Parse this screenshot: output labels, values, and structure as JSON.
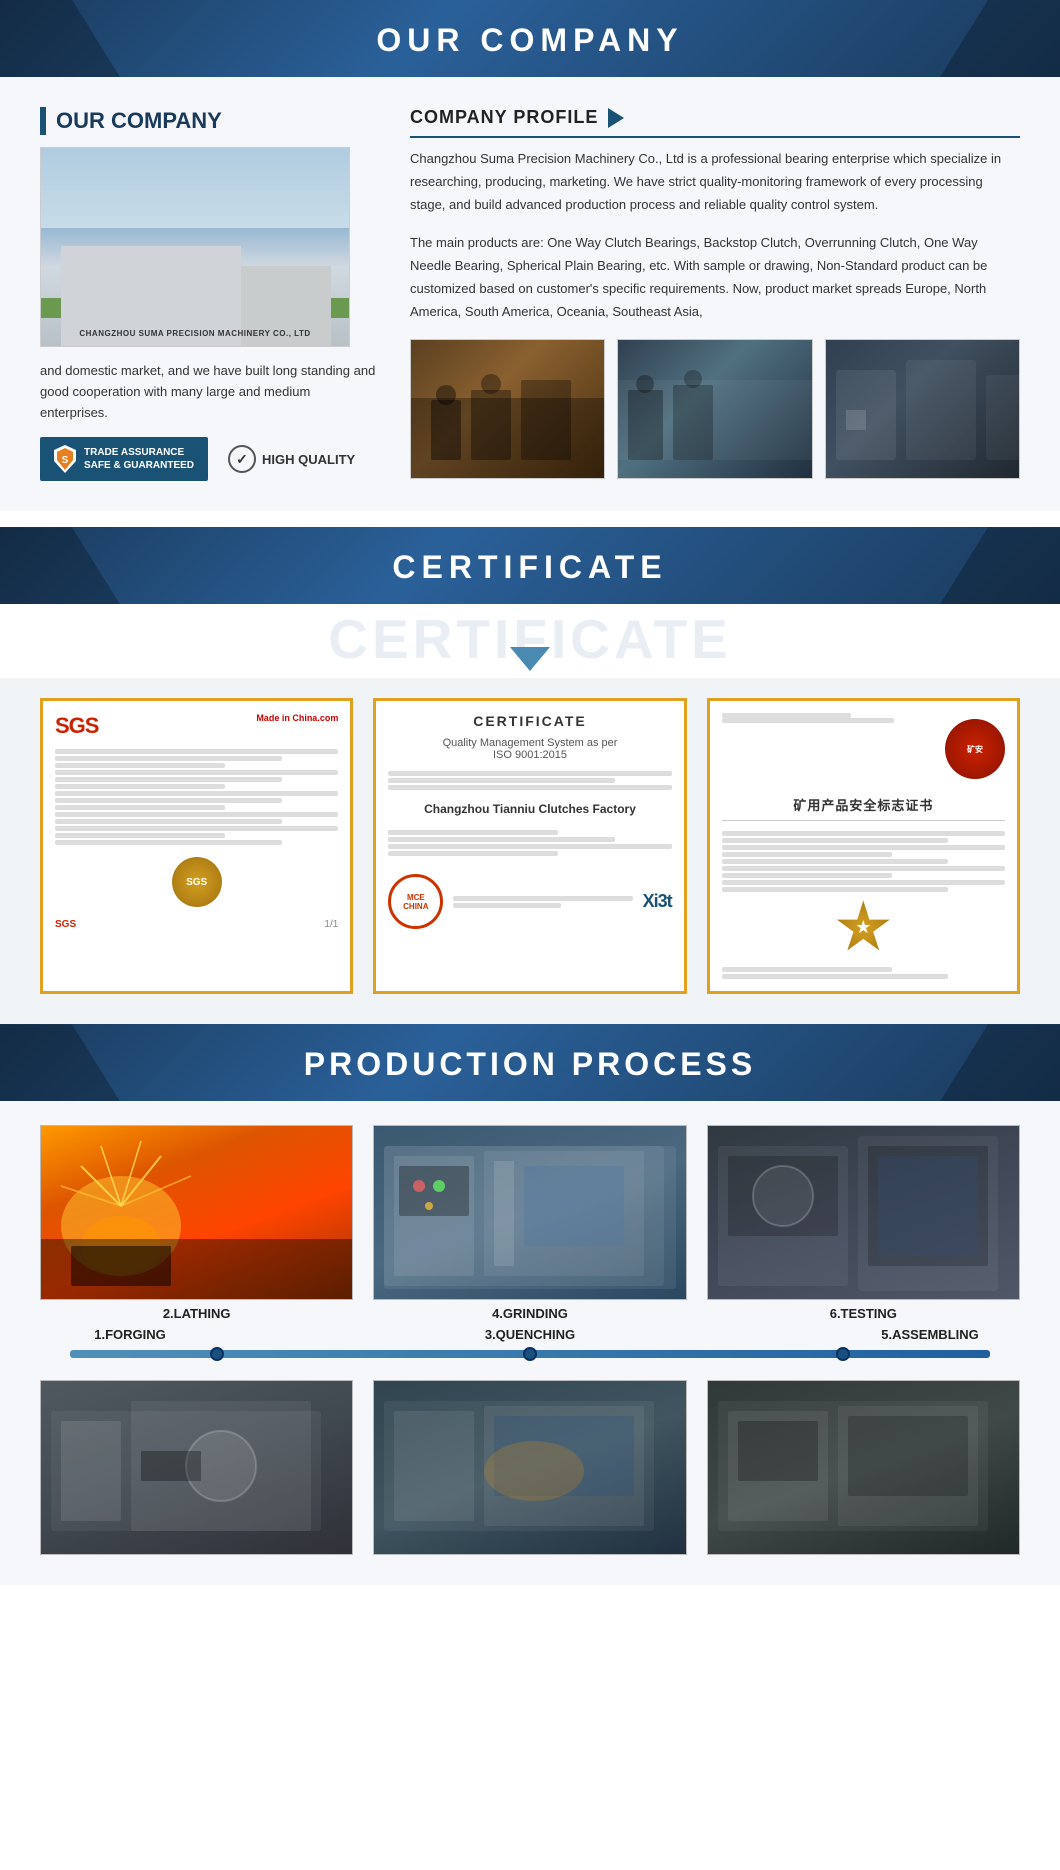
{
  "header": {
    "title": "OUR  COMPANY"
  },
  "company": {
    "section_title": "OUR COMPANY",
    "profile_title": "COMPANY PROFILE",
    "profile_text1": "Changzhou Suma Precision Machinery Co., Ltd is a professional bearing enterprise which specialize in researching, producing, marketing. We have strict quality-monitoring framework of every processing stage, and build advanced production process and reliable quality control system.",
    "profile_text2": "The main products are: One Way Clutch Bearings, Backstop Clutch, Overrunning Clutch, One Way Needle Bearing, Spherical Plain Bearing, etc. With sample or drawing, Non-Standard product can be customized based on customer's specific requirements. Now, product market spreads Europe, North America, South America, Oceania, Southeast Asia,",
    "text_below": "and domestic market, and we have built long standing and good cooperation with many large and medium enterprises.",
    "badge_trade": "TRADE ASSURANCE\nSAFE & GUARANTEED",
    "badge_quality": "HIGH QUALITY",
    "building_text": "CHANGZHOU SUMA PRECISION MACHINERY CO., LTD"
  },
  "certificate": {
    "title": "CERTIFICATE",
    "watermark": "CERTIFICATE",
    "card1_logo": "SGS",
    "card1_badge": "Made in China.com",
    "card1_bottom": "SGS",
    "card2_title": "CERTIFICATE",
    "card2_subtitle": "Quality Management System as per\nISO 9001:2015",
    "card2_org": "Changzhou Tianniu Clutches Factory",
    "card2_seal_text": "MCE CHINA",
    "card2_logo": "Xi3t",
    "card3_title": "矿用产品安全标志证书",
    "card3_seal": "★"
  },
  "production": {
    "title": "PRODUCTION PROCESS",
    "steps": [
      {
        "id": "1",
        "label": "1.FORGING",
        "position": "bottom"
      },
      {
        "id": "2",
        "label": "2.LATHING",
        "position": "top"
      },
      {
        "id": "3",
        "label": "3.QUENCHING",
        "position": "bottom"
      },
      {
        "id": "4",
        "label": "4.GRINDING",
        "position": "top"
      },
      {
        "id": "5",
        "label": "5.ASSEMBLING",
        "position": "bottom"
      },
      {
        "id": "6",
        "label": "6.TESTING",
        "position": "top"
      }
    ]
  }
}
